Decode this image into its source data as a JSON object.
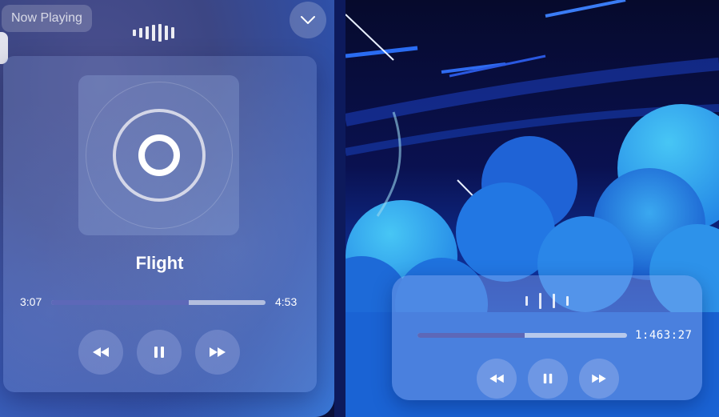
{
  "main_player": {
    "now_playing_label": "Now Playing",
    "track_title": "Flight",
    "current_time": "3:07",
    "total_time": "4:53",
    "progress": 0.64,
    "controls": {
      "rewind_icon": "rewind-icon",
      "pause_icon": "pause-icon",
      "forward_icon": "fast-forward-icon"
    },
    "collapse_icon": "chevron-down-icon"
  },
  "mini_player": {
    "time_display": "1:463:27",
    "progress": 0.51,
    "controls": {
      "rewind_icon": "rewind-icon",
      "pause_icon": "pause-icon",
      "forward_icon": "fast-forward-icon"
    }
  },
  "colors": {
    "accent": "#5d68b8",
    "track_bg": "#dce1f0"
  }
}
